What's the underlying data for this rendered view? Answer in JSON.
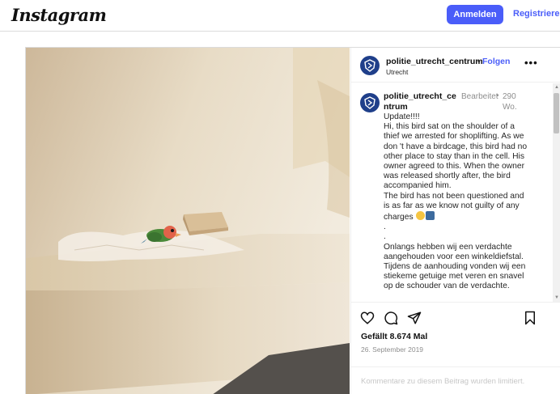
{
  "header": {
    "logo_text": "Instagram",
    "login_label": "Anmelden",
    "register_label": "Registrieren"
  },
  "post": {
    "author": "politie_utrecht_centrum",
    "separator": "•",
    "follow_label": "Folgen",
    "location": "Utrecht",
    "more_icon": "more-horizontal-icon",
    "caption": {
      "author_line": "politie_utrecht_centrum",
      "edited": "Bearbeitet",
      "dot": "•",
      "age": "290 Wo.",
      "paragraphs": [
        "Update!!!!",
        "Hi, this bird sat on the shoulder of a thief we arrested for shoplifting. As we don 't have a birdcage, this bird had no other place to stay than in the cell. His owner agreed to this. When the owner was released shortly after, the bird accompanied him.",
        "The bird has not been questioned and is as far as we know not guilty of any charges",
        ".",
        ".",
        " Onlangs hebben wij een verdachte aangehouden voor een winkeldiefstal. Tijdens de aanhouding vonden wij een stiekeme getuige met veren en snavel op de schouder van de verdachte."
      ]
    },
    "likes": "Gefällt 8.674 Mal",
    "date": "26. September 2019",
    "comments_limited": "Kommentare zu diesem Beitrag wurden limitiert.",
    "icons": {
      "like": "heart-icon",
      "comment": "comment-icon",
      "share": "share-icon",
      "save": "bookmark-icon"
    },
    "colors": {
      "accent": "#4a5df9",
      "avatar": "#1f3f8a"
    }
  }
}
